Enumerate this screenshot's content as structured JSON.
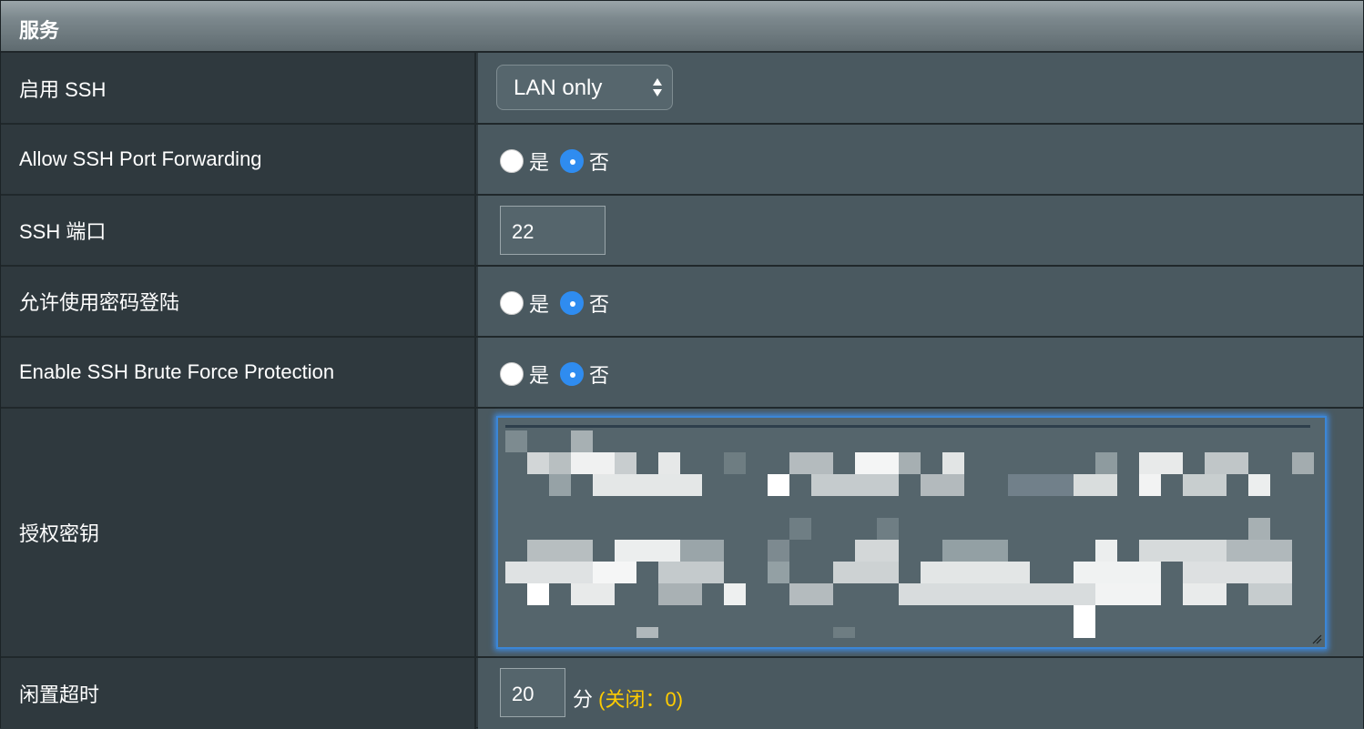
{
  "section": {
    "title": "服务"
  },
  "rows": {
    "enable_ssh": {
      "label": "启用 SSH",
      "selected": "LAN only"
    },
    "port_forwarding": {
      "label": "Allow SSH Port Forwarding",
      "yes": "是",
      "no": "否",
      "value": "否"
    },
    "ssh_port": {
      "label": "SSH 端口",
      "value": "22"
    },
    "password_login": {
      "label": "允许使用密码登陆",
      "yes": "是",
      "no": "否",
      "value": "否"
    },
    "brute_force": {
      "label": "Enable SSH Brute Force Protection",
      "yes": "是",
      "no": "否",
      "value": "否"
    },
    "authorized_keys": {
      "label": "授权密钥"
    },
    "idle_timeout": {
      "label": "闲置超时",
      "value": "20",
      "unit": "分",
      "hint": "(关闭：0)"
    }
  },
  "colors": {
    "label_bg": "#2f393e",
    "value_bg": "#4a5960",
    "radio_checked": "#2f8cf0",
    "hint": "#ffcc00",
    "focus_border": "#3b86d6"
  },
  "icons": {
    "select_arrows": "up-down-arrows-icon",
    "resize": "resize-handle-icon"
  }
}
